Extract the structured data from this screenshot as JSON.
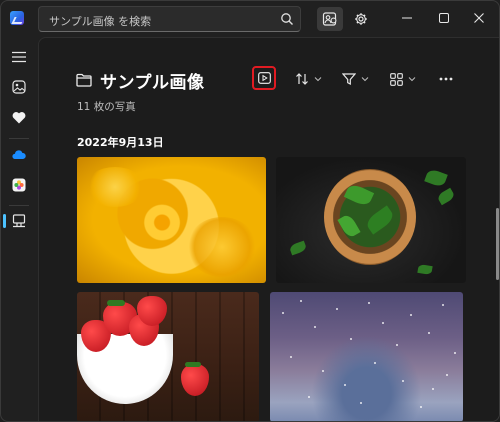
{
  "search": {
    "placeholder": "サンプル画像 を検索"
  },
  "page": {
    "title": "サンプル画像",
    "count": "11 枚の写真",
    "date_header": "2022年9月13日"
  },
  "colors": {
    "accent": "#4cc2ff",
    "highlight": "#e11b22",
    "background": "#1c1c1c"
  },
  "sidebar": {
    "items": [
      {
        "icon": "hamburger-menu-icon"
      },
      {
        "icon": "gallery-icon"
      },
      {
        "icon": "favorites-heart-icon"
      },
      {
        "icon": "onedrive-cloud-icon"
      },
      {
        "icon": "icloud-photos-icon"
      },
      {
        "icon": "this-pc-icon"
      }
    ]
  },
  "photos": [
    {
      "subject": "yellow rose"
    },
    {
      "subject": "spinach bowl"
    },
    {
      "subject": "strawberries"
    },
    {
      "subject": "snow bokeh"
    }
  ]
}
